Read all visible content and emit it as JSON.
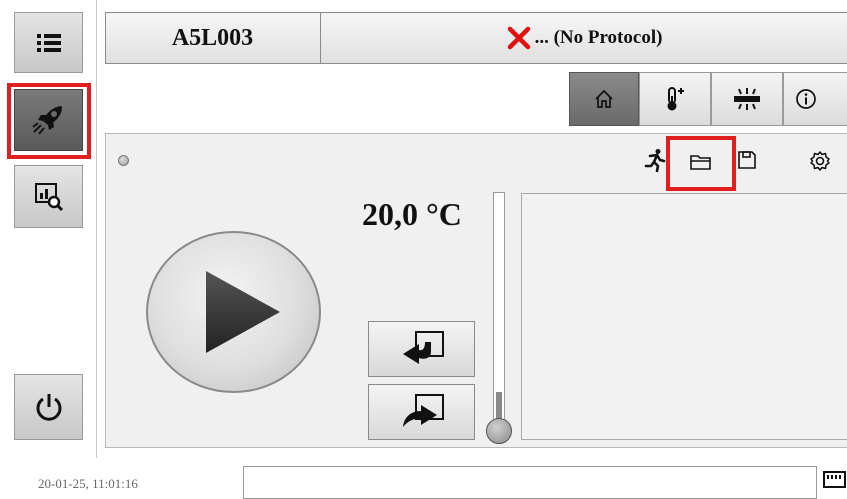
{
  "header": {
    "device_id": "A5L003",
    "protocol_status_icon": "red-x-icon",
    "protocol_text": "... (No Protocol)"
  },
  "sidebar": {
    "items": [
      {
        "name": "menu-icon",
        "active": false
      },
      {
        "name": "rocket-icon",
        "active": true
      },
      {
        "name": "chart-search-icon",
        "active": false
      },
      {
        "name": "power-icon",
        "active": false
      }
    ]
  },
  "tabs": [
    {
      "name": "home-icon",
      "active": true
    },
    {
      "name": "thermometer-plus-icon",
      "active": false
    },
    {
      "name": "light-bar-icon",
      "active": false
    },
    {
      "name": "info-icon",
      "active": false
    }
  ],
  "toolbar": [
    "run-icon",
    "open-folder-icon",
    "save-icon",
    "settings-icon"
  ],
  "main": {
    "temperature": "20,0 °C",
    "status_led": "grey",
    "temperature_slider_level": 0.05
  },
  "footer": {
    "timestamp": "20-01-25, 11:01:16"
  },
  "colors": {
    "highlight": "#e02020",
    "status_x": "#e01010",
    "panel": "#f0f0f0"
  }
}
